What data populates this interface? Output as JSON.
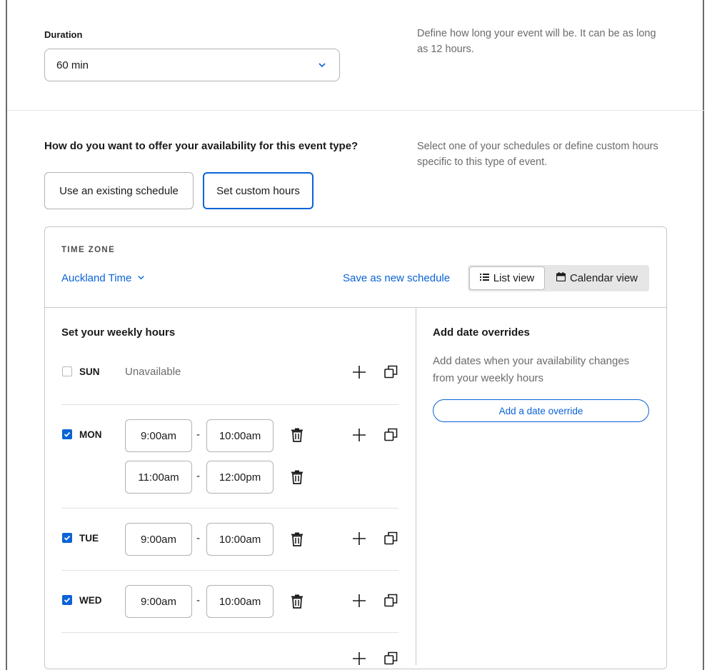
{
  "duration": {
    "label": "Duration",
    "value": "60 min",
    "help": "Define how long your event will be. It can be as long as 12 hours."
  },
  "availability": {
    "question": "How do you want to offer your availability for this event type?",
    "help": "Select one of your schedules or define custom hours specific to this type of event.",
    "options": [
      "Use an existing schedule",
      "Set custom hours"
    ],
    "selected": "Set custom hours"
  },
  "panel": {
    "timezone_label": "TIME ZONE",
    "timezone": "Auckland Time",
    "save_link": "Save as new schedule",
    "views": [
      "List view",
      "Calendar view"
    ],
    "active_view": "List view"
  },
  "weekly": {
    "title": "Set your weekly hours",
    "unavailable_text": "Unavailable",
    "days": [
      {
        "day": "SUN",
        "checked": false,
        "slots": []
      },
      {
        "day": "MON",
        "checked": true,
        "slots": [
          {
            "start": "9:00am",
            "end": "10:00am"
          },
          {
            "start": "11:00am",
            "end": "12:00pm"
          }
        ]
      },
      {
        "day": "TUE",
        "checked": true,
        "slots": [
          {
            "start": "9:00am",
            "end": "10:00am"
          }
        ]
      },
      {
        "day": "WED",
        "checked": true,
        "slots": [
          {
            "start": "9:00am",
            "end": "10:00am"
          }
        ]
      }
    ],
    "separator": "-"
  },
  "overrides": {
    "title": "Add date overrides",
    "text": "Add dates when your availability changes from your weekly hours",
    "button": "Add a date override"
  },
  "colors": {
    "accent": "#0b63d6",
    "muted": "#6b6b6b",
    "border": "#b2b2b2"
  },
  "icons": [
    "chevron-down-icon",
    "list-icon",
    "calendar-icon",
    "checkbox-icon",
    "trash-icon",
    "plus-icon",
    "copy-icon"
  ]
}
